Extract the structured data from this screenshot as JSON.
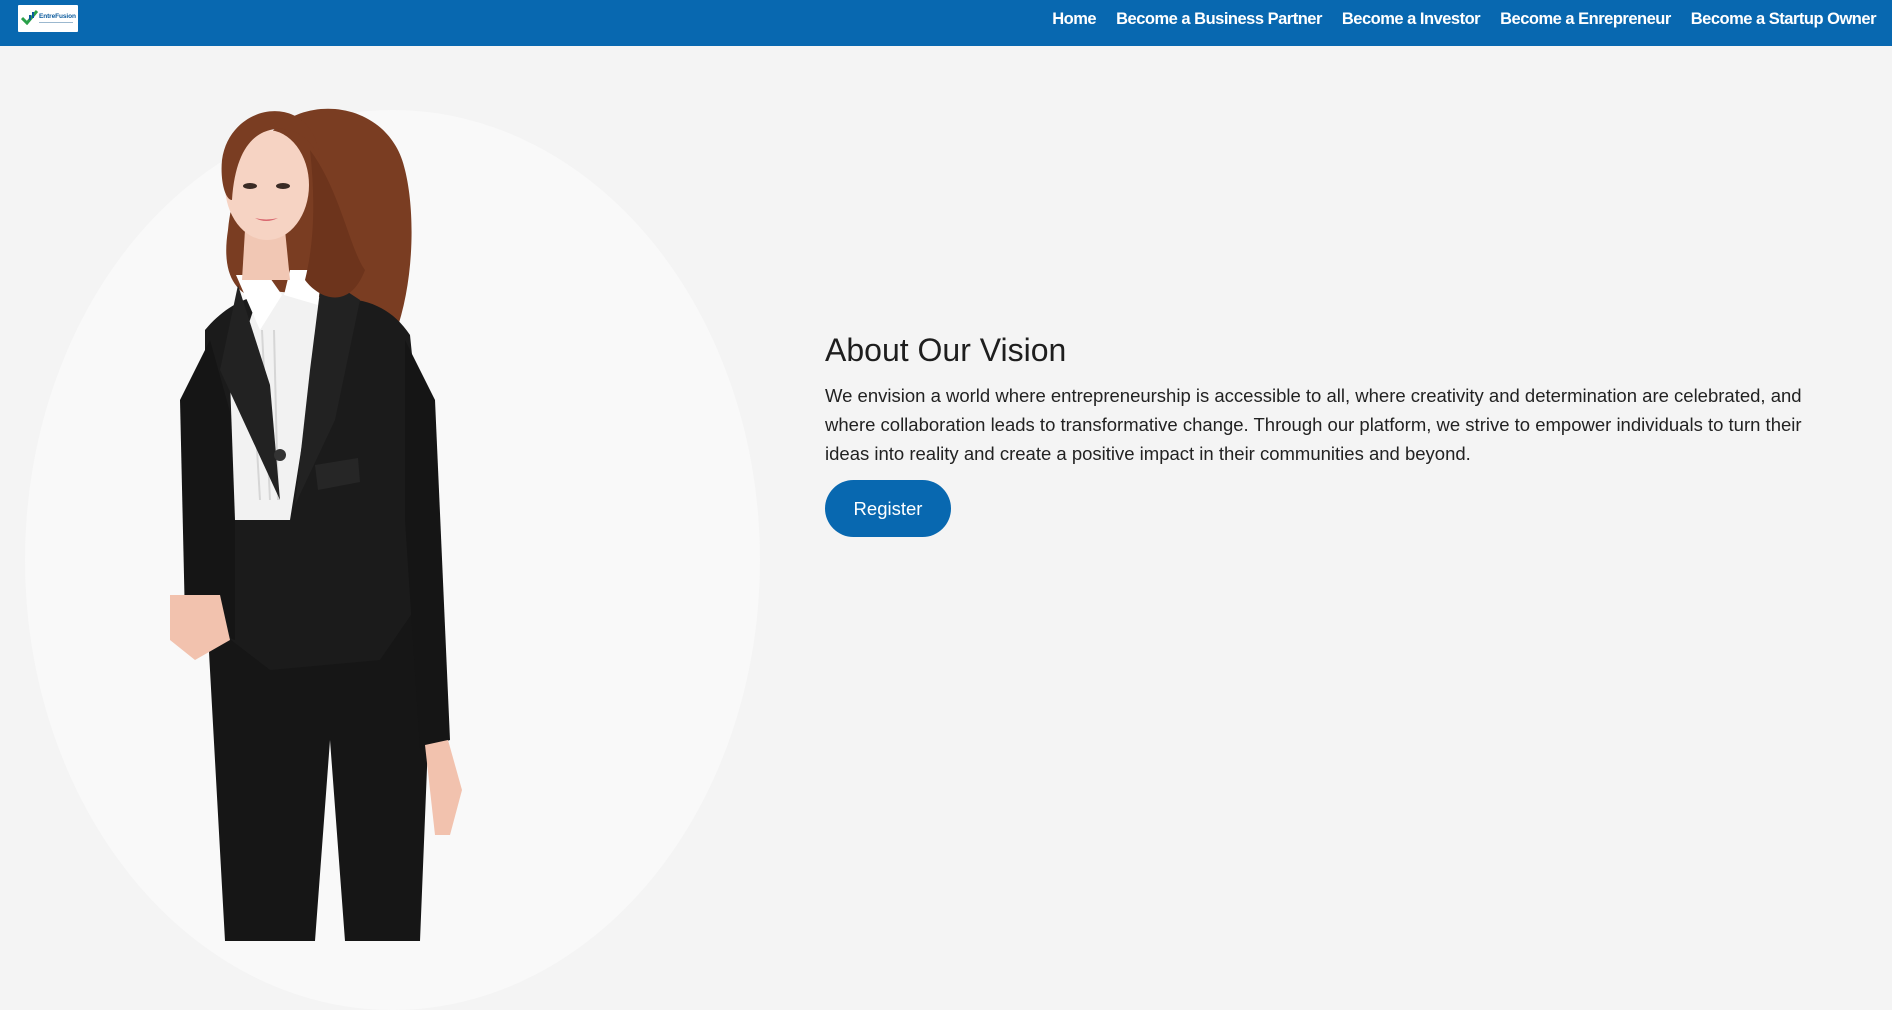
{
  "logo": {
    "text": "EntreFusion"
  },
  "nav": {
    "links": [
      "Home",
      "Become a Business Partner",
      "Become a Investor",
      "Become a Enrepreneur",
      "Become a Startup Owner"
    ]
  },
  "about": {
    "heading": "About Our Vision",
    "paragraph_line1": "We envision a world where entrepreneurship is accessible to all, where creativity and determination are celebrated, and",
    "paragraph_line2": "where collaboration leads to transformative change. Through our platform, we strive to empower individuals to turn their",
    "paragraph_line3": "ideas into reality and create a positive impact in their communities and beyond."
  },
  "cta": {
    "register_label": "Register"
  },
  "colors": {
    "brand": "#0868b0",
    "background": "#f4f4f4",
    "text": "#1e1e1e"
  }
}
